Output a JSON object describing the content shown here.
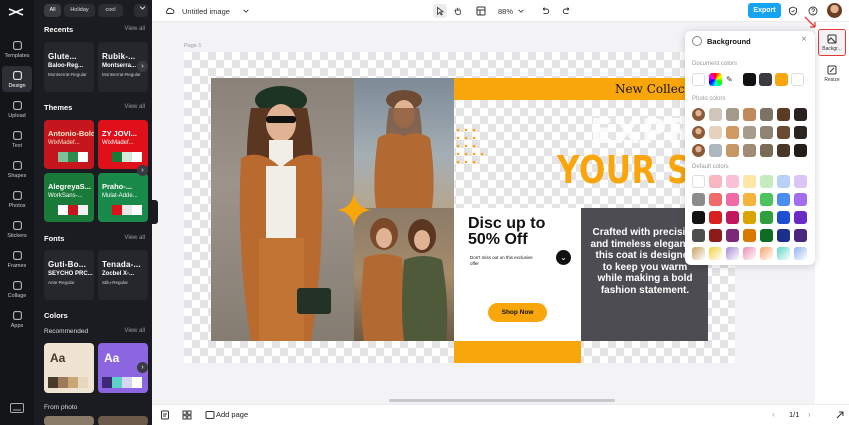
{
  "rail": {
    "items": [
      {
        "label": "Templates",
        "icon": "templates-icon"
      },
      {
        "label": "Design",
        "icon": "design-icon"
      },
      {
        "label": "Upload",
        "icon": "upload-icon"
      },
      {
        "label": "Text",
        "icon": "text-icon"
      },
      {
        "label": "Shapes",
        "icon": "shapes-icon"
      },
      {
        "label": "Photos",
        "icon": "photos-icon"
      },
      {
        "label": "Stickers",
        "icon": "stickers-icon"
      },
      {
        "label": "Frames",
        "icon": "frames-icon"
      },
      {
        "label": "Collage",
        "icon": "collage-icon"
      },
      {
        "label": "Apps",
        "icon": "apps-icon"
      }
    ],
    "active": "Design"
  },
  "panel": {
    "chips": [
      "All",
      "Holiday",
      "cool"
    ],
    "recents": {
      "title": "Recents",
      "view_all": "View all",
      "items": [
        {
          "l1": "Glute...",
          "l2": "Baloo-Reg...",
          "l3": "Montserrat-Regular"
        },
        {
          "l1": "Rubik-...",
          "l2": "Montserra...",
          "l3": "Montserrat-Regular"
        }
      ]
    },
    "themes": {
      "title": "Themes",
      "view_all": "View all",
      "items": [
        {
          "t1": "Antonio-Bold",
          "t2": "WixMadef...",
          "bg": "#c4161c",
          "fg": "#ffe6c8",
          "sw": [
            "#c4161c",
            "#7fbf9a",
            "#2f8a4d",
            "#ffffff"
          ]
        },
        {
          "t1": "ZY JOVI...",
          "t2": "WixMadef...",
          "bg": "#e0101a",
          "fg": "#ffffff",
          "sw": [
            "#e0101a",
            "#1a7a3a",
            "#d3e8d8",
            "#ffffff"
          ]
        },
        {
          "t1": "AlegreyaS...",
          "t2": "WorkSans-...",
          "bg": "#1a7a3a",
          "fg": "#ffffff",
          "sw": [
            "#1a7a3a",
            "#ffffff",
            "#c4161c",
            "#f2f2f2"
          ]
        },
        {
          "t1": "Praho-...",
          "t2": "Mulat-Adde...",
          "bg": "#1a8a4a",
          "fg": "#ffffff",
          "sw": [
            "#1a8a4a",
            "#e0101a",
            "#e8e8e8",
            "#ffffff"
          ]
        }
      ]
    },
    "fonts": {
      "title": "Fonts",
      "view_all": "View all",
      "items": [
        {
          "l1": "Guti-Bo...",
          "l2": "SEYCHO PRC...",
          "l3": "Ante-Regular"
        },
        {
          "l1": "Tenada-...",
          "l2": "Zocbel X-...",
          "l3": "Stilu-Regular"
        }
      ]
    },
    "colors": {
      "title": "Colors",
      "recommended": "Recommended",
      "view_all": "View all",
      "items": [
        {
          "aa": "Aa",
          "bg": "#efe3d2",
          "fg": "#4a3a2a",
          "bars": [
            "#4a3a2a",
            "#9c7a55",
            "#c9a678",
            "#e8d7bf"
          ]
        },
        {
          "aa": "Aa",
          "bg": "#8b66e0",
          "fg": "#ffffff",
          "bars": [
            "#3c2a78",
            "#5bd1c8",
            "#d6d6f0",
            "#ffffff"
          ]
        }
      ],
      "from_photo": "From photo"
    }
  },
  "topbar": {
    "title": "Untitled image",
    "zoom": "88%",
    "export": "Export"
  },
  "canvas": {
    "page_label": "Page 1",
    "banner_title": "New Collect",
    "express_1": "EXPRE",
    "express_2": "YOUR STY",
    "disc_1": "Disc up to",
    "disc_2": "50% Off",
    "disc_note": "Don't miss out on this exclusive offer",
    "shop": "Shop Now",
    "dark_text": "Crafted with precision and timeless elegance, this coat is designed to keep you warm while making a bold fashion statement.",
    "accent": "#f9a60c"
  },
  "bottombar": {
    "add_page": "Add page",
    "page_count": "1/1"
  },
  "bg_panel": {
    "title": "Background",
    "doc_label": "Document colors",
    "doc_colors": [
      "#ffffff",
      "#111111",
      "#3a3a3f",
      "#f9a60c",
      "#ffffff"
    ],
    "photo_label": "Photo colors",
    "photo_rows": [
      [
        "#cfc5b8",
        "#a39a8c",
        "#c08a5c",
        "#7c7366",
        "#5b3b22",
        "#2a2220"
      ],
      [
        "#e6d3bd",
        "#d19a62",
        "#a79c8b",
        "#8e8375",
        "#6b4b30",
        "#2b2420"
      ],
      [
        "#aeb7bd",
        "#c69765",
        "#a08c76",
        "#7a6a58",
        "#4a3626",
        "#231d19"
      ]
    ],
    "default_label": "Default colors",
    "default_rows": [
      [
        "#ffffff",
        "#f7b7c0",
        "#f9c0d8",
        "#fde6a8",
        "#c5ecbe",
        "#b8d2f7",
        "#d9c6f5"
      ],
      [
        "#8c8c8c",
        "#ef6a6a",
        "#f06aa8",
        "#f5b43a",
        "#4cc35d",
        "#4b8df0",
        "#a26ef0"
      ],
      [
        "#111111",
        "#d81e1e",
        "#c2185b",
        "#d9a300",
        "#2e9e3e",
        "#1f4fd1",
        "#6a2bc4"
      ],
      [
        "#4d4d4d",
        "#8c1b1b",
        "#7b2a78",
        "#d87a00",
        "#0d6b24",
        "#1c2f8c",
        "#4a2680"
      ],
      [
        "#c8a25f",
        "#f4d03f",
        "#a58bd6",
        "#ee8bb0",
        "#f7a36a",
        "#5fd6c6",
        "#8fb3f2"
      ]
    ]
  },
  "right_rail": {
    "items": [
      {
        "label": "Backgr...",
        "icon": "background-icon"
      },
      {
        "label": "Resize",
        "icon": "resize-icon"
      }
    ]
  }
}
